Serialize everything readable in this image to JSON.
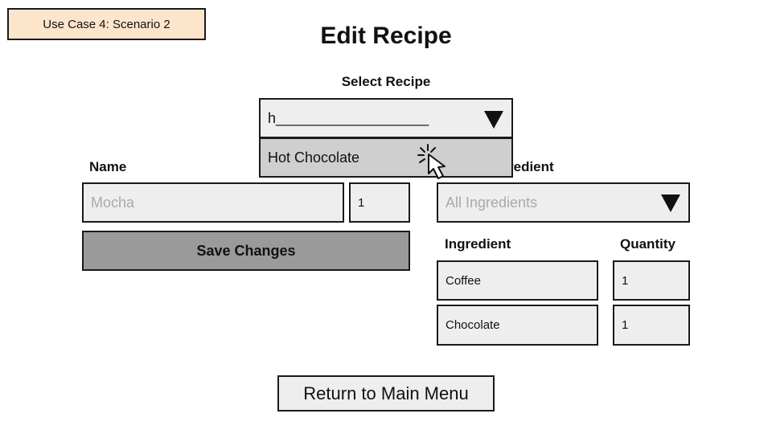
{
  "scenario_label": "Use Case 4: Scenario 2",
  "title": "Edit Recipe",
  "select_recipe": {
    "label": "Select Recipe",
    "typed_value": "h___________________",
    "options": [
      "Hot Chocolate"
    ]
  },
  "name_section": {
    "label": "Name",
    "name_placeholder": "Mocha",
    "number_value": "1"
  },
  "ingredient_section": {
    "label_visible": "redient",
    "select_placeholder": "All Ingredients",
    "columns": {
      "ingredient": "Ingredient",
      "quantity": "Quantity"
    },
    "rows": [
      {
        "ingredient": "Coffee",
        "quantity": "1"
      },
      {
        "ingredient": "Chocolate",
        "quantity": "1"
      }
    ]
  },
  "buttons": {
    "save": "Save Changes",
    "return": "Return to Main Menu"
  },
  "colors": {
    "scenario_bg": "#fde5cc",
    "field_bg": "#eeeeee",
    "dropdown_bg": "#cfcfcf",
    "save_bg": "#9a9a9a"
  },
  "icons": {
    "select_caret": "triangle-down-icon",
    "ingredient_caret": "triangle-down-icon",
    "cursor": "pointer-click-icon"
  }
}
